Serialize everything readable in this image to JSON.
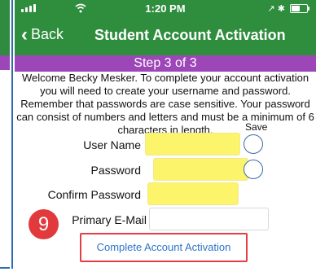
{
  "status_bar": {
    "time": "1:20 PM",
    "status_icons": [
      "signal-icon",
      "wifi-icon",
      "location-icon",
      "bluetooth-icon",
      "battery-icon"
    ],
    "right_icons_text": "↗ ✱"
  },
  "nav": {
    "back_label": "Back",
    "title": "Student Account Activation"
  },
  "step": {
    "label": "Step 3 of 3"
  },
  "welcome_text": "Welcome Becky Mesker. To complete your account activation you will need to create your username and password. Remember that passwords are case sensitive. Your password can consist of numbers and letters and must be a minimum of 6 characters in length.",
  "form": {
    "save_label": "Save",
    "username_label": "User Name",
    "password_label": "Password",
    "confirm_label": "Confirm Password",
    "email_label": "Primary E-Mail"
  },
  "badge_number": "9",
  "activate_button_label": "Complete Account Activation",
  "colors": {
    "header_green": "#2f8d3e",
    "step_purple": "#9d46b8",
    "field_yellow": "#fcf46a",
    "badge_red": "#e2393d",
    "highlight_border": "#e43e45",
    "link_blue": "#2c74c8"
  }
}
